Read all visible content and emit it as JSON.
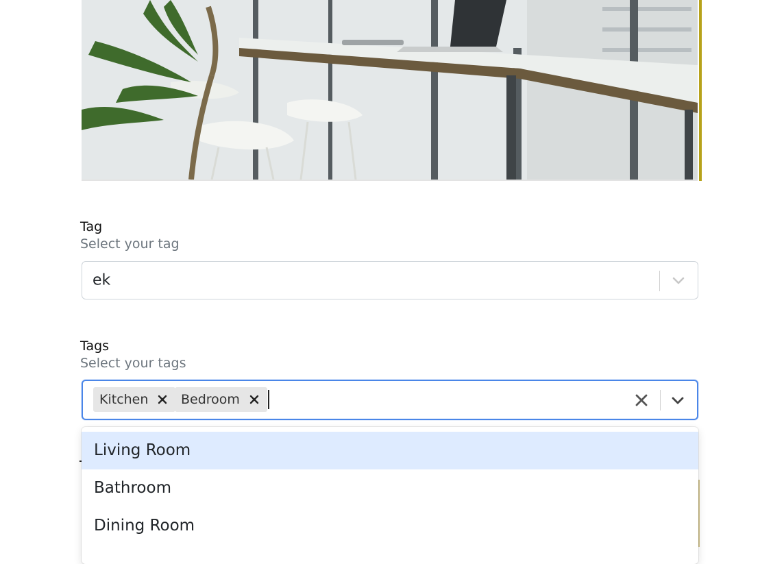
{
  "tag_field": {
    "label": "Tag",
    "help": "Select your tag",
    "value": "ek"
  },
  "tags_field": {
    "label": "Tags",
    "help": "Select your tags",
    "chips": [
      "Kitchen",
      "Bedroom"
    ],
    "options": [
      "Living Room",
      "Bathroom",
      "Dining Room"
    ]
  },
  "colors": {
    "focus_border": "#4a86e8",
    "option_highlight": "#deebff",
    "chip_bg": "#e6e6e6",
    "help_text": "#6c757d"
  },
  "icons": [
    "chevron-down-icon",
    "clear-icon",
    "remove-chip-icon"
  ]
}
